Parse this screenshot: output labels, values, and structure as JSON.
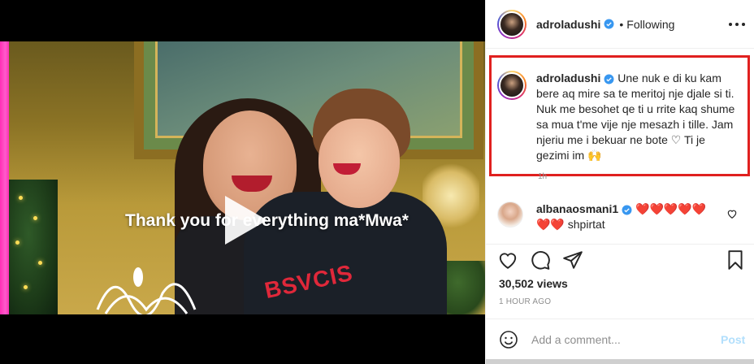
{
  "video": {
    "overlay_caption": "Thank you for everything ma*Mwa*",
    "shirt_text": "BSVCIS"
  },
  "header": {
    "username": "adroladushi",
    "separator": "•",
    "follow_status": "Following"
  },
  "caption": {
    "username": "adroladushi",
    "text": "Une nuk e di ku kam bere aq mire sa te meritoj nje djale si ti. Nuk me besohet qe ti u rrite kaq shume sa mua t'me vije nje mesazh i tille. Jam njeriu me i bekuar ne bote ♡ Ti je gezimi im 🙌",
    "time": "1h"
  },
  "comment": {
    "username": "albanaosmani1",
    "hearts": "❤️❤️❤️❤️❤️ ❤️❤️",
    "text": "shpirtat"
  },
  "stats": {
    "views": "30,502 views",
    "time": "1 HOUR AGO"
  },
  "add_comment": {
    "placeholder": "Add a comment...",
    "post_label": "Post"
  },
  "colors": {
    "highlight_border": "#e0201f",
    "verified_blue": "#3897f0",
    "post_button": "#b2dffc"
  }
}
